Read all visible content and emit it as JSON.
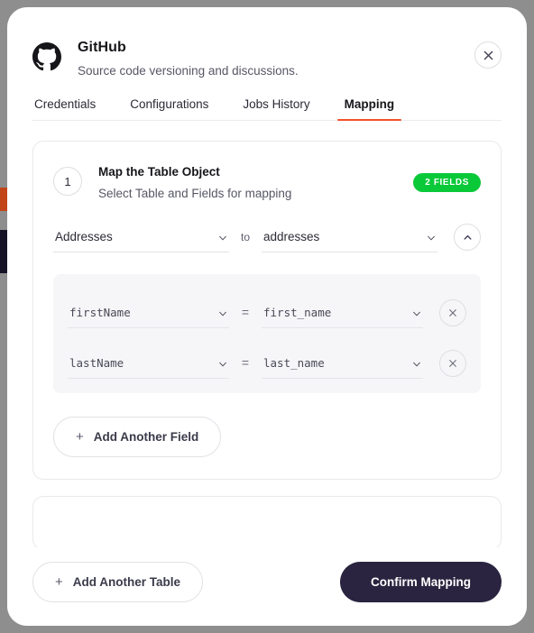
{
  "background": {
    "overlay_color": "#8e8e8e",
    "fragments": [
      {
        "name": "orange-strip",
        "color": "#c2451a"
      },
      {
        "name": "navy-strip",
        "color": "#171326"
      }
    ]
  },
  "header": {
    "icon": "github-logo-icon",
    "title": "GitHub",
    "subtitle": "Source code versioning and discussions.",
    "close_icon": "close-icon"
  },
  "tabs": [
    {
      "label": "Credentials",
      "active": false
    },
    {
      "label": "Configurations",
      "active": false
    },
    {
      "label": "Jobs History",
      "active": false
    },
    {
      "label": "Mapping",
      "active": true
    }
  ],
  "tab_accent_color": "#f4502b",
  "mapping_card": {
    "step_number": "1",
    "title": "Map the Table Object",
    "subtitle": "Select Table and Fields for mapping",
    "badge": {
      "label": "2 FIELDS",
      "color": "#0ac939"
    },
    "table_row": {
      "source_value": "Addresses",
      "separator": "to",
      "target_value": "addresses",
      "chevron_icon": "chevron-down-icon",
      "collapse_icon": "chevron-up-icon"
    },
    "fields": [
      {
        "source_value": "firstName",
        "separator": "=",
        "target_value": "first_name",
        "chevron_icon": "chevron-down-icon",
        "remove_icon": "close-icon"
      },
      {
        "source_value": "lastName",
        "separator": "=",
        "target_value": "last_name",
        "chevron_icon": "chevron-down-icon",
        "remove_icon": "close-icon"
      }
    ],
    "add_field_label": "Add Another Field",
    "add_field_plus": "+"
  },
  "footer": {
    "add_table_label": "Add Another Table",
    "add_table_plus": "+",
    "confirm_label": "Confirm Mapping",
    "confirm_color": "#2a2440"
  }
}
